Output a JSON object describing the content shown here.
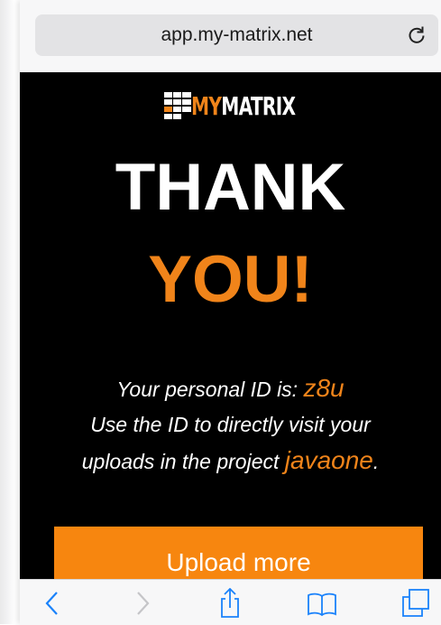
{
  "browser": {
    "url": "app.my-matrix.net",
    "icons": {
      "reload": "reload-icon",
      "back": "back-chevron-icon",
      "forward": "forward-chevron-icon",
      "share": "share-icon",
      "bookmarks": "bookmarks-icon",
      "tabs": "tabs-icon"
    }
  },
  "page": {
    "logo": {
      "my": "MY",
      "matrix": "MATRIX"
    },
    "title_line1": "THANK",
    "title_line2": "YOU!",
    "message": {
      "line1_prefix": "Your personal ID is: ",
      "personal_id": "z8u",
      "line2": "Use the ID to directly visit your",
      "line3_prefix": "uploads in the project ",
      "project": "javaone",
      "line3_suffix": "."
    },
    "upload_button": "Upload more"
  },
  "colors": {
    "accent": "#f0841a",
    "button": "#f7860f",
    "background": "#000000",
    "ios_blue": "#1a82fb"
  }
}
